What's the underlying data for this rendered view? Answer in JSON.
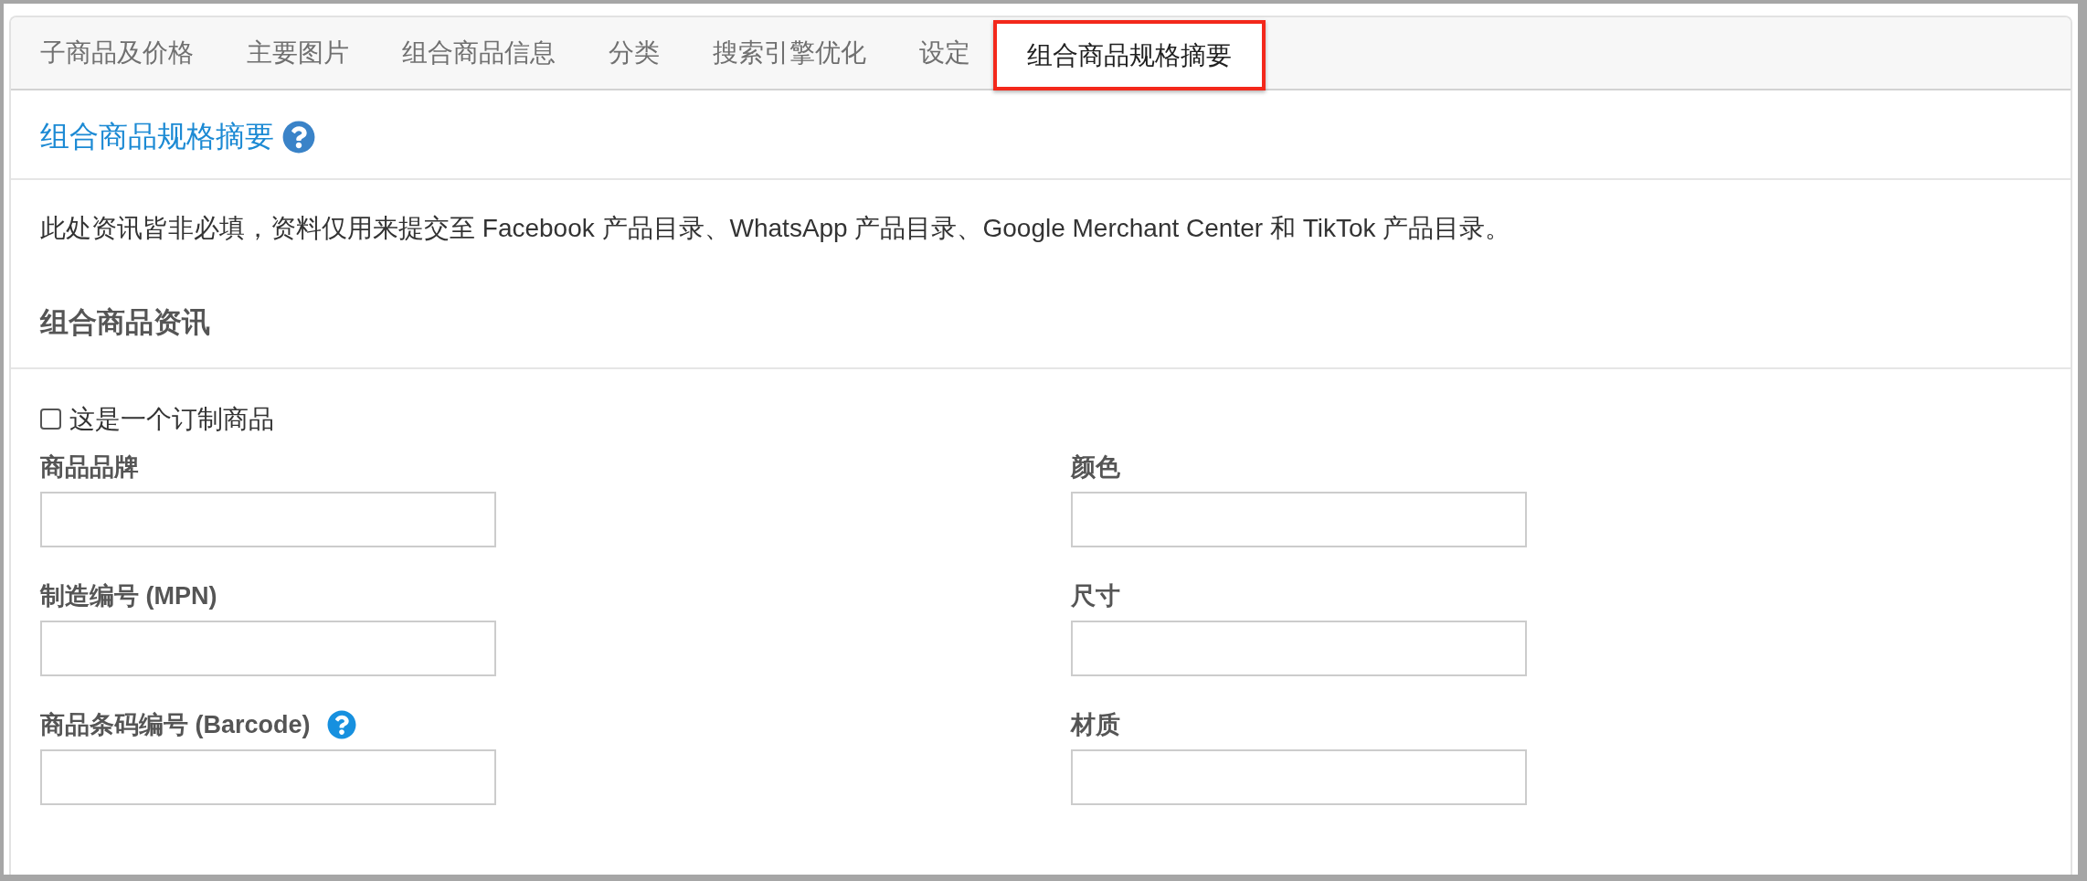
{
  "tabs": [
    {
      "label": "子商品及价格",
      "selected": false,
      "highlighted": false
    },
    {
      "label": "主要图片",
      "selected": false,
      "highlighted": false
    },
    {
      "label": "组合商品信息",
      "selected": false,
      "highlighted": false
    },
    {
      "label": "分类",
      "selected": false,
      "highlighted": false
    },
    {
      "label": "搜索引擎优化",
      "selected": false,
      "highlighted": false
    },
    {
      "label": "设定",
      "selected": false,
      "highlighted": false
    },
    {
      "label": "组合商品规格摘要",
      "selected": true,
      "highlighted": true
    }
  ],
  "section": {
    "title": "组合商品规格摘要"
  },
  "description": "此处资讯皆非必填，资料仅用来提交至 Facebook 产品目录、WhatsApp 产品目录、Google Merchant Center 和 TikTok 产品目录。",
  "subsection": {
    "title": "组合商品资讯"
  },
  "custom_product": {
    "label": "这是一个订制商品",
    "checked": false
  },
  "left_column": {
    "fields": [
      {
        "label": "商品品牌",
        "help": false
      },
      {
        "label": "制造编号 (MPN)",
        "help": false
      },
      {
        "label": "商品条码编号 (Barcode)",
        "help": true
      }
    ]
  },
  "right_column": {
    "fields": [
      {
        "label": "颜色",
        "help": false
      },
      {
        "label": "尺寸",
        "help": false
      },
      {
        "label": "材质",
        "help": false
      }
    ]
  }
}
